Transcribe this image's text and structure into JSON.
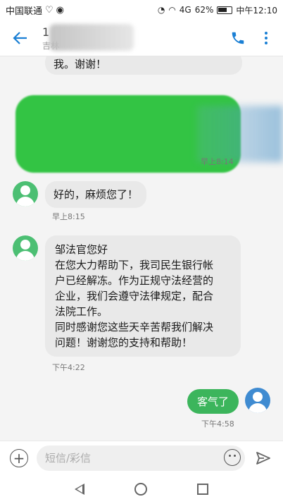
{
  "status_bar": {
    "carrier": "中国联通",
    "battery": "62%",
    "time": "中午12:10",
    "network": "4G"
  },
  "header": {
    "contact_number_partial": "1",
    "contact_sub": "吉林"
  },
  "messages": [
    {
      "direction": "in",
      "text": "我。谢谢！",
      "time": ""
    },
    {
      "direction": "in",
      "text": "",
      "time": "早上8:14"
    },
    {
      "direction": "in",
      "text": "好的，麻烦您了！",
      "time": "早上8:15"
    },
    {
      "direction": "in",
      "lines": [
        "邹法官您好",
        "在您大力帮助下，我司民生银行帐",
        "户已经解冻。作为正规守法经营的",
        "企业，我们会遵守法律规定，配合",
        "法院工作。",
        "同时感谢您这些天辛苦帮我们解决",
        "问题！谢谢您的支持和帮助！"
      ],
      "time": "下午4:22"
    },
    {
      "direction": "out",
      "text": "客气了",
      "time": "下午4:58"
    }
  ],
  "composer": {
    "placeholder": "短信/彩信"
  }
}
